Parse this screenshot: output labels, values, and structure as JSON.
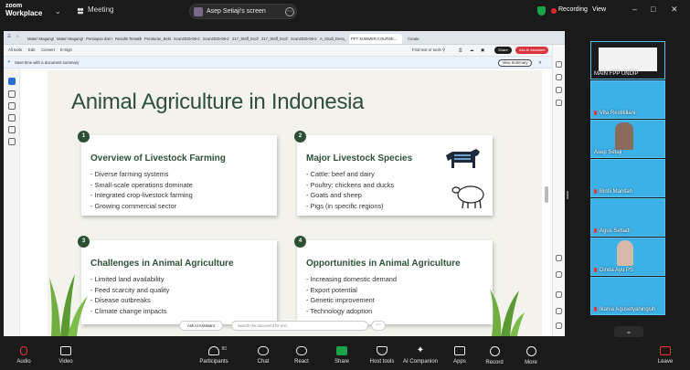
{
  "app": {
    "logo_line1": "zoom",
    "logo_line2": "Workplace",
    "meeting_label": "Meeting",
    "share_title": "Asep Setiaji's screen",
    "recording": "Recording",
    "view": "View",
    "record_color": "#e02828",
    "shield_color": "#1aa34a"
  },
  "browser": {
    "tabs": [
      "Materi Magang#...",
      "Materi Magang#...",
      "Persiapan dari P...",
      "Results Tematik...",
      "Peraturan_Bekti...",
      "Scan2025-06-2...",
      "Scan2025-06-2...",
      "217_Staff_Exch...",
      "217_Staff_Exch...",
      "Scan2025-06-2...",
      "A_Studi_Desa_...",
      "PPT SUMMER COURSE...",
      "Create"
    ],
    "toolbar": {
      "all_tools": "All tools",
      "edit": "Edit",
      "convert": "Convert",
      "esign": "E-Sign",
      "find_text": "Find text or tools",
      "share": "Share",
      "ask_ai": "Ask AI Assistant"
    },
    "banner": "Save time with a document summary",
    "view_summary": "View Summary",
    "ask_ai_bottom": "Ask AI Assistant",
    "search_doc_placeholder": "Search the document for text"
  },
  "slide": {
    "title": "Animal Agriculture in Indonesia",
    "cards": [
      {
        "num": "1",
        "heading": "Overview of Livestock Farming",
        "items": [
          "- Diverse farming systems",
          "- Small-scale operations dominate",
          "- Integrated crop-livestock farming",
          "- Growing commercial sector"
        ]
      },
      {
        "num": "2",
        "heading": "Major Livestock Species",
        "items": [
          "- Cattle: beef and dairy",
          "- Poultry: chickens and ducks",
          "- Goats and sheep",
          "- Pigs (in specific regions)"
        ]
      },
      {
        "num": "3",
        "heading": "Challenges in Animal Agriculture",
        "items": [
          "- Limited land availability",
          "- Feed scarcity and quality",
          "- Disease outbreaks",
          "- Climate change impacts"
        ]
      },
      {
        "num": "4",
        "heading": "Opportunities in Animal Agriculture",
        "items": [
          "- Increasing domestic demand",
          "- Export potential",
          "- Genetic improvement",
          "- Technology adoption"
        ]
      }
    ]
  },
  "gallery": [
    {
      "name": "MAIN FPP UNDIP"
    },
    {
      "name": "Vita Restitiliani"
    },
    {
      "name": "Asep Setaji"
    },
    {
      "name": "Bintii Manifah"
    },
    {
      "name": "Agus Setiadi"
    },
    {
      "name": "Dinda Ayu PS"
    },
    {
      "name": "Ikania Agusetyaningsih"
    }
  ],
  "bottombar": [
    {
      "label": "Audio"
    },
    {
      "label": "Video"
    },
    {
      "label": "Participants",
      "count": "80"
    },
    {
      "label": "Chat"
    },
    {
      "label": "React"
    },
    {
      "label": "Share"
    },
    {
      "label": "Host tools"
    },
    {
      "label": "AI Companion"
    },
    {
      "label": "Apps"
    },
    {
      "label": "Record"
    },
    {
      "label": "More"
    },
    {
      "label": "Leave"
    }
  ]
}
